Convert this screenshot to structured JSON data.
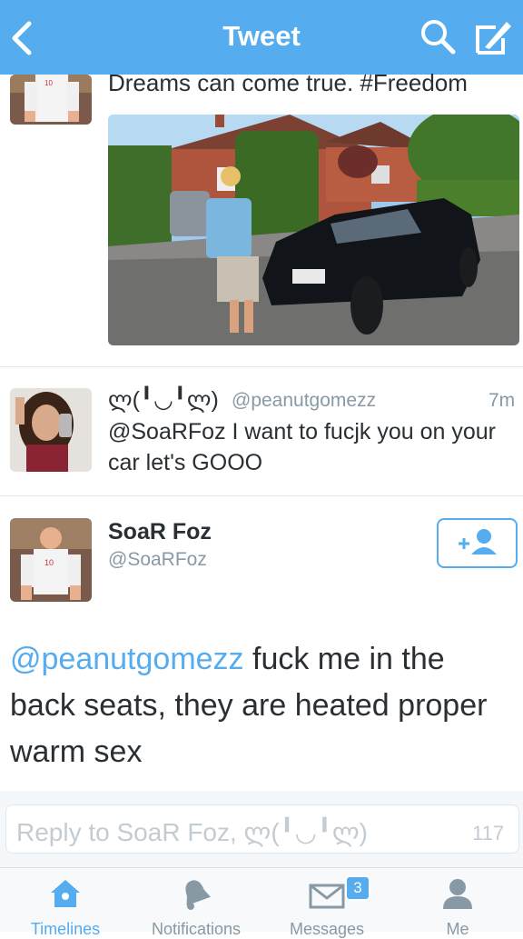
{
  "header": {
    "title": "Tweet"
  },
  "tweet_prev": {
    "text": "Dreams can come true. #Freedom"
  },
  "reply_tweet": {
    "name": "ლ(╹◡╹ლ)",
    "handle": "@peanutgomezz",
    "time": "7m",
    "text": "@SoaRFoz I want to fucjk you on your car let's GOOO"
  },
  "main_tweet": {
    "name": "SoaR Foz",
    "handle": "@SoaRFoz",
    "mention": "@peanutgomezz",
    "text": " fuck me in the back seats, they are heated proper warm sex"
  },
  "reply_box": {
    "placeholder": "Reply to SoaR Foz, ლ(╹◡╹ლ)",
    "count": "117"
  },
  "tabs": [
    {
      "label": "Timelines"
    },
    {
      "label": "Notifications"
    },
    {
      "label": "Messages",
      "badge": "3"
    },
    {
      "label": "Me"
    }
  ],
  "colors": {
    "accent": "#55acee",
    "text": "#292f33",
    "muted": "#8899a6"
  }
}
